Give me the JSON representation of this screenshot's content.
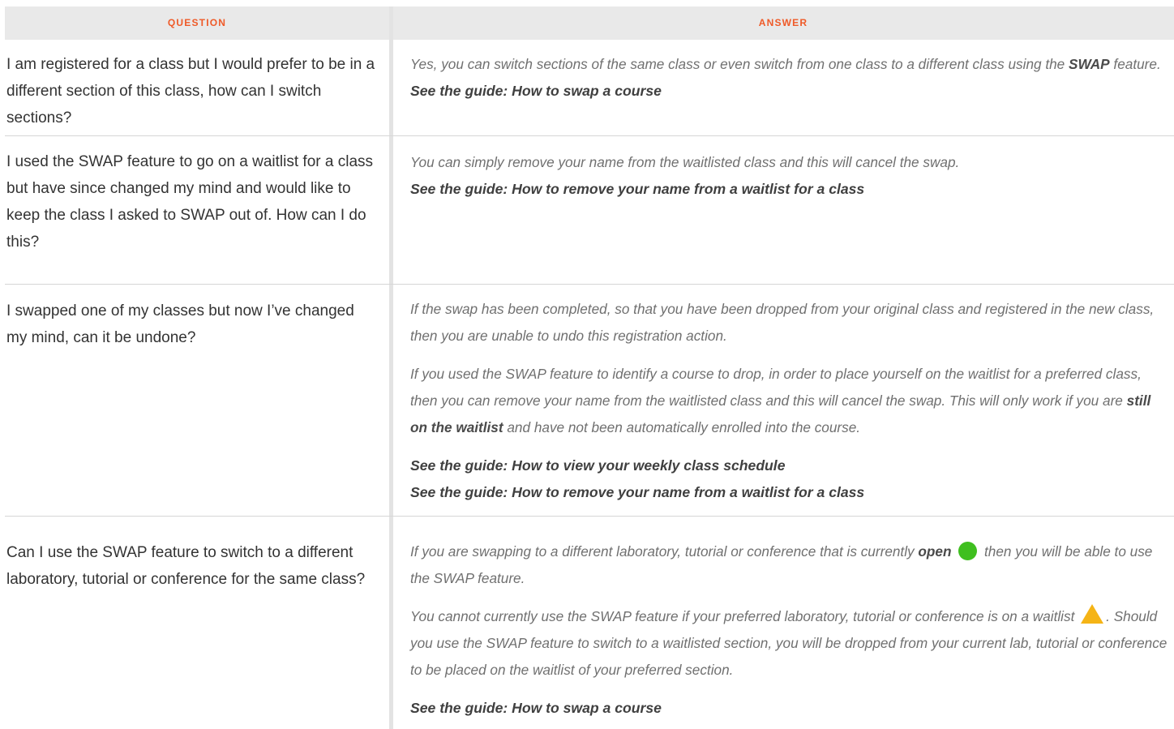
{
  "table": {
    "header": {
      "question": "QUESTION",
      "answer": "ANSWER"
    },
    "rows": [
      {
        "question": "I am registered for a class but I would prefer to be in a different section of this class, how can I switch sections?",
        "answer": {
          "p1_a": "Yes, you can switch sections of the same class or even switch from one class to a different class using the ",
          "p1_strong": "SWAP",
          "p1_b": " feature.",
          "guide1": "See the guide: How to swap a course"
        }
      },
      {
        "question": "I used the SWAP feature to go on a waitlist for a class but have since changed my mind and would like to keep the class I asked to SWAP out of. How can I do this?",
        "answer": {
          "p1": "You can simply remove your name from the waitlisted class and this will cancel the swap.",
          "guide1": "See the guide: How to remove your name from a waitlist for a class"
        }
      },
      {
        "question": "I swapped one of my classes but now I’ve changed my mind, can it be undone?",
        "answer": {
          "p1": "If the swap has been completed, so that you have been dropped from your original class and registered in the new class, then you are unable to undo this registration action.",
          "p2_a": "If you used the SWAP feature to identify a course to drop, in order to place yourself on the waitlist for a preferred class, then you can remove your name from the waitlisted class and this will cancel the swap. This will only work if you are ",
          "p2_strong": "still on the waitlist",
          "p2_b": " and have not been automatically enrolled into the course.",
          "guide1": "See the guide: How to view your weekly class schedule",
          "guide2": "See the guide: How to remove your name from a waitlist for a class"
        }
      },
      {
        "question": "Can I use the SWAP feature to switch to a different laboratory, tutorial or conference for the same class?",
        "answer": {
          "p1_a": "If you are swapping to a different laboratory, tutorial or conference that is currently ",
          "p1_strong": "open",
          "p1_b": " then you will be able to use the SWAP feature.",
          "p2_a": "You cannot currently use the SWAP feature if your preferred laboratory, tutorial or conference is on a waitlist ",
          "p2_b": ". Should you use the SWAP feature to switch to a waitlisted section, you will be dropped from your current lab, tutorial or conference to be placed on the waitlist of your preferred section.",
          "guide1": "See the guide: How to swap a course"
        }
      }
    ]
  },
  "icons": {
    "open_status": "green-circle-icon",
    "waitlist_status": "yellow-triangle-icon"
  },
  "colors": {
    "header_text": "#ef5a28",
    "header_bg": "#e9e9e9",
    "open": "#3fbf1f",
    "waitlist": "#f5b416"
  }
}
